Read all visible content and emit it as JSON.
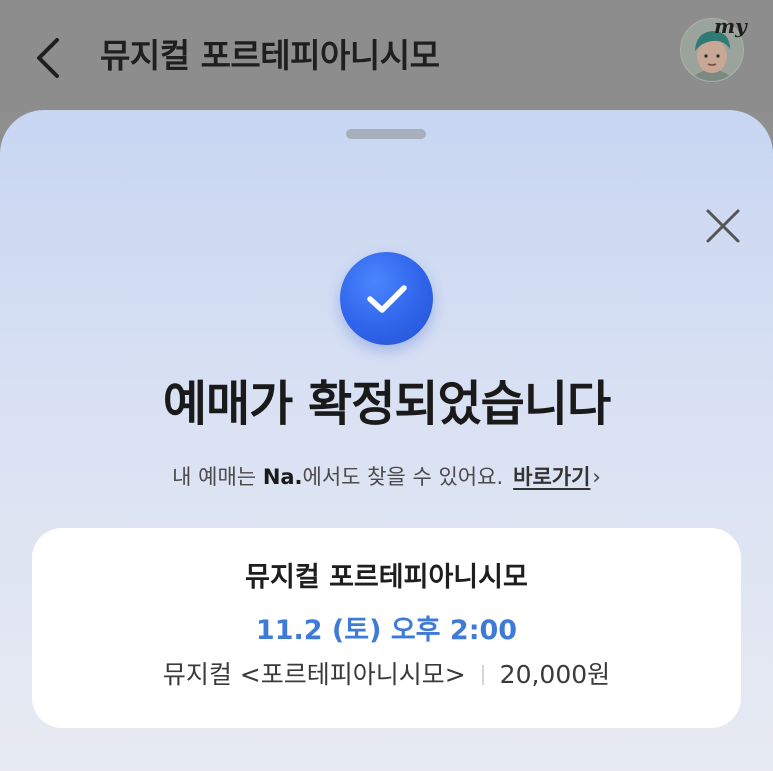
{
  "header": {
    "title": "뮤지컬 포르테피아니시모",
    "back_icon": "chevron-left-icon",
    "avatar_badge": "my"
  },
  "sheet": {
    "close_icon": "close-icon",
    "status_icon": "check-circle-icon",
    "headline": "예매가 확정되었습니다",
    "subline_prefix": "내 예매는 ",
    "subline_brand": "Na.",
    "subline_suffix": "에서도 찾을 수 있어요.",
    "shortcut_label": "바로가기",
    "shortcut_chevron": "›"
  },
  "booking": {
    "title": "뮤지컬 포르테피아니시모",
    "datetime": "11.2 (토) 오후 2:00",
    "category_name": "뮤지컬 <포르테피아니시모>",
    "price": "20,000원"
  },
  "colors": {
    "accent_blue": "#3e7bd8",
    "check_circle": "#2f64ea",
    "dim_overlay": "#8d8d8d"
  }
}
